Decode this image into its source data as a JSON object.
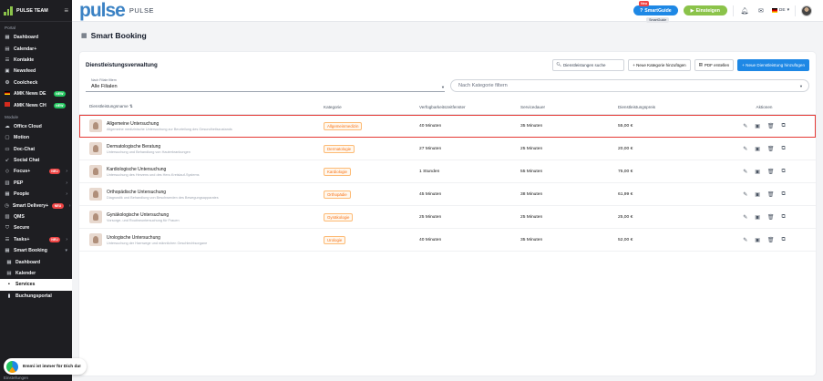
{
  "sidebar": {
    "title": "PULSE TEAM",
    "portal_label": "Portal",
    "module_label": "Module",
    "bottom_text": "Einstellungen",
    "portal_items": [
      {
        "label": "Dashboard",
        "icon": "grid-icon"
      },
      {
        "label": "Calendar+",
        "icon": "calendar-icon"
      },
      {
        "label": "Kontakte",
        "icon": "contacts-icon"
      },
      {
        "label": "Newsfeed",
        "icon": "news-icon"
      },
      {
        "label": "Coolcheck",
        "icon": "check-icon"
      },
      {
        "label": "AMK News DE",
        "icon": "flag-de-icon",
        "badge": "NEW"
      },
      {
        "label": "AMK News CH",
        "icon": "flag-ch-icon",
        "badge": "NEW"
      }
    ],
    "module_items": [
      {
        "label": "Office Cloud",
        "icon": "cloud-icon"
      },
      {
        "label": "Motion",
        "icon": "motion-icon"
      },
      {
        "label": "Doc-Chat",
        "icon": "chat-icon"
      },
      {
        "label": "Social Chat",
        "icon": "social-icon"
      },
      {
        "label": "Focus+",
        "icon": "focus-icon",
        "badge": "NEU"
      },
      {
        "label": "PEP",
        "icon": "pep-icon"
      },
      {
        "label": "People",
        "icon": "people-icon"
      },
      {
        "label": "Smart Delivery+",
        "icon": "delivery-icon",
        "badge": "NEU"
      },
      {
        "label": "QMS",
        "icon": "qms-icon"
      },
      {
        "label": "Secure",
        "icon": "shield-icon"
      },
      {
        "label": "Tasks+",
        "icon": "tasks-icon",
        "badge": "NEU"
      },
      {
        "label": "Smart Booking",
        "icon": "booking-icon"
      },
      {
        "label": "Dashboard",
        "icon": "grid-icon"
      },
      {
        "label": "Kalender",
        "icon": "calendar-icon"
      },
      {
        "label": "Services",
        "icon": "services-icon"
      },
      {
        "label": "Buchungsportal",
        "icon": "portal-icon"
      }
    ]
  },
  "topbar": {
    "brand": "pulse",
    "brand_sub": "PULSE",
    "smartguide": "SmartGuide",
    "smartguide_tag": "Neu",
    "smartguide_tooltip": "SmartGuide",
    "einstiegen": "Einsteigen",
    "lang": "DE"
  },
  "page": {
    "title": "Smart Booking"
  },
  "card": {
    "title": "Dienstleistungsverwaltung",
    "search_placeholder": "Dienstleistungen suche",
    "btn_kategorie": "+ Neue Kategorie hinzufügen",
    "btn_pdf": "PDF erstellen",
    "btn_add": "+ Neue Dienstleistung hinzufügen",
    "filiale_label": "Nach Filiale filtern",
    "filiale_value": "Alle Filialen",
    "kategorie_placeholder": "Nach Kategorie filtern"
  },
  "table": {
    "headers": {
      "name": "Dienstleistungsname",
      "kategorie": "Kategorie",
      "verfuegbarkeit": "Verfügbarkeitszeitfenster",
      "dauer": "Servicedauer",
      "preis": "Dienstleistungspreis",
      "aktionen": "Aktionen"
    },
    "rows": [
      {
        "name": "Allgemeine Untersuchung",
        "desc": "Allgemeine medizinische Untersuchung zur Beurteilung des Gesundheitszustands",
        "kategorie": "Allgemeinmedizin",
        "zeitfenster": "40 Minuten",
        "dauer": "35 Minuten",
        "preis": "55,00 €"
      },
      {
        "name": "Dermatologische Beratung",
        "desc": "Untersuchung und Behandlung von Hauterkrankungen",
        "kategorie": "Dermatologie",
        "zeitfenster": "27 Minuten",
        "dauer": "25 Minuten",
        "preis": "20,00 €"
      },
      {
        "name": "Kardiologische Untersuchung",
        "desc": "Untersuchung des Herzens und des Herz-Kreislauf-Systems",
        "kategorie": "Kardiologie",
        "zeitfenster": "1 Stunden",
        "dauer": "55 Minuten",
        "preis": "75,00 €"
      },
      {
        "name": "Orthopädische Untersuchung",
        "desc": "Diagnostik und Behandlung von Beschwerden des Bewegungsapparates",
        "kategorie": "Orthopädie",
        "zeitfenster": "45 Minuten",
        "dauer": "38 Minuten",
        "preis": "61,99 €"
      },
      {
        "name": "Gynäkologische Untersuchung",
        "desc": "Vorsorge- und Routineuntersuchung für Frauen",
        "kategorie": "Gynäkologie",
        "zeitfenster": "25 Minuten",
        "dauer": "25 Minuten",
        "preis": "25,00 €"
      },
      {
        "name": "Urologische Untersuchung",
        "desc": "Untersuchung der Harnwege und männlichen Geschlechtsorgane",
        "kategorie": "Urologie",
        "zeitfenster": "40 Minuten",
        "dauer": "35 Minuten",
        "preis": "52,00 €"
      }
    ]
  },
  "chat": {
    "text": "Emmi ist immer für Dich da!"
  },
  "colors": {
    "accent_blue": "#1e88e5",
    "accent_green": "#8bc34a",
    "category_orange": "#f97316",
    "selection_red": "#e53935"
  }
}
